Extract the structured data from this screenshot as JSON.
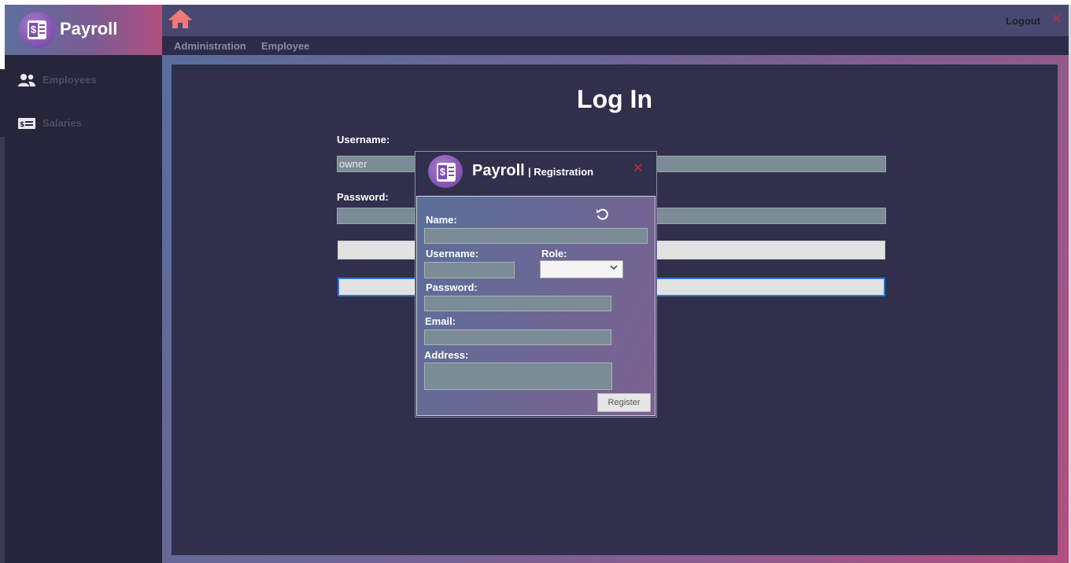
{
  "app": {
    "title": "Payroll"
  },
  "topbar": {
    "home_icon": "home-icon",
    "logout_label": "Logout",
    "close_icon": "close-icon"
  },
  "menu": {
    "items": [
      {
        "label": "Administration"
      },
      {
        "label": "Employee"
      }
    ]
  },
  "sidebar": {
    "items": [
      {
        "label": "Employees",
        "icon": "users-icon"
      },
      {
        "label": "Salaries",
        "icon": "salary-card-icon"
      }
    ]
  },
  "login": {
    "title": "Log In",
    "username_label": "Username:",
    "username_value": "owner",
    "password_label": "Password:",
    "password_value": ""
  },
  "registration": {
    "brand": "Payroll",
    "subtitle": "| Registration",
    "name_label": "Name:",
    "username_label": "Username:",
    "role_label": "Role:",
    "role_value": "",
    "password_label": "Password:",
    "email_label": "Email:",
    "address_label": "Address:",
    "register_label": "Register"
  },
  "colors": {
    "accent_red": "#c0303a",
    "home_icon": "#f07878",
    "panel": "#30304c"
  }
}
